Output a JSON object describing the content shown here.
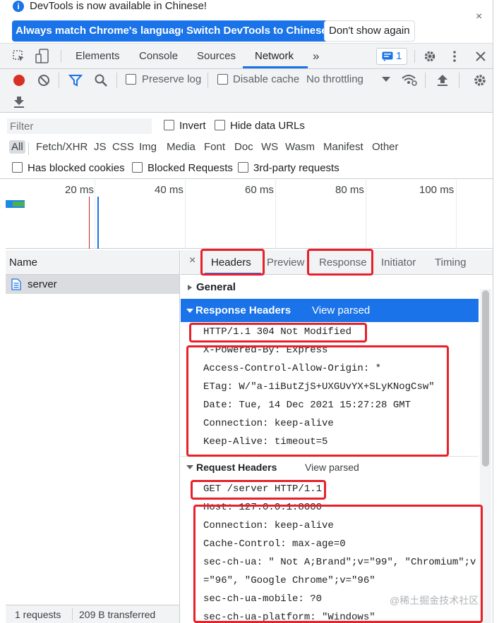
{
  "infobar": {
    "message": "DevTools is now available in Chinese!",
    "buttons": [
      "Always match Chrome's language",
      "Switch DevTools to Chinese",
      "Don't show again"
    ],
    "close": "×"
  },
  "tabs": {
    "items": [
      "Elements",
      "Console",
      "Sources",
      "Network"
    ],
    "more": "»",
    "active": "Network",
    "issues_count": "1"
  },
  "toolbar": {
    "preserve_log": "Preserve log",
    "disable_cache": "Disable cache",
    "throttling": "No throttling"
  },
  "filter": {
    "placeholder": "Filter",
    "invert": "Invert",
    "hide_data_urls": "Hide data URLs",
    "types": [
      "All",
      "Fetch/XHR",
      "JS",
      "CSS",
      "Img",
      "Media",
      "Font",
      "Doc",
      "WS",
      "Wasm",
      "Manifest",
      "Other"
    ],
    "has_blocked_cookies": "Has blocked cookies",
    "blocked_requests": "Blocked Requests",
    "third_party": "3rd-party requests"
  },
  "timeline": {
    "ticks": [
      "20 ms",
      "40 ms",
      "60 ms",
      "80 ms",
      "100 ms"
    ]
  },
  "requests": {
    "column": "Name",
    "rows": [
      "server"
    ],
    "status": {
      "count": "1 requests",
      "transferred": "209 B transferred"
    }
  },
  "details": {
    "tabs": [
      "Headers",
      "Preview",
      "Response",
      "Initiator",
      "Timing"
    ],
    "close": "×",
    "general": "General",
    "response_headers_title": "Response Headers",
    "view_parsed": "View parsed",
    "response_status_line": "HTTP/1.1 304 Not Modified",
    "response_headers": [
      "X-Powered-By: Express",
      "Access-Control-Allow-Origin: *",
      "ETag: W/\"a-1iButZjS+UXGUvYX+SLyKNogCsw\"",
      "Date: Tue, 14 Dec 2021 15:27:28 GMT",
      "Connection: keep-alive",
      "Keep-Alive: timeout=5"
    ],
    "request_headers_title": "Request Headers",
    "request_line": "GET /server HTTP/1.1",
    "request_headers": [
      "Host: 127.0.0.1:8000",
      "Connection: keep-alive",
      "Cache-Control: max-age=0",
      "sec-ch-ua: \" Not A;Brand\";v=\"99\", \"Chromium\";v",
      "=\"96\", \"Google Chrome\";v=\"96\"",
      "sec-ch-ua-mobile: ?0",
      "sec-ch-ua-platform: \"Windows\""
    ]
  },
  "watermark": "@稀土掘金技术社区",
  "colors": {
    "accent": "#1a73e8",
    "highlight_box": "#e8202a",
    "record": "#d93025"
  }
}
